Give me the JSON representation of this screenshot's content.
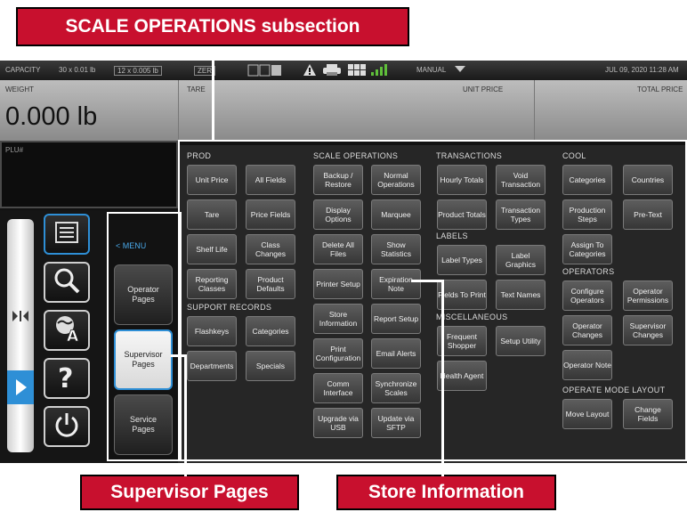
{
  "callouts": {
    "top": "SCALE OPERATIONS subsection",
    "left": "Supervisor Pages",
    "right": "Store Information"
  },
  "status": {
    "capacity": "CAPACITY",
    "cap1": "30 x 0.01 lb",
    "cap2": "12 x 0.005 lb",
    "zero": "ZER",
    "manual": "MANUAL",
    "date": "JUL 09, 2020 11:28 AM"
  },
  "weighbar": {
    "weight_label": "WEIGHT",
    "tare_label": "TARE",
    "unit_price_label": "UNIT PRICE",
    "total_price_label": "TOTAL PRICE",
    "weight_value": "0.000 lb"
  },
  "plu_label": "PLU#",
  "menu_link": "< MENU",
  "pages": {
    "operator": "Operator Pages",
    "supervisor": "Supervisor Pages",
    "service": "Service Pages"
  },
  "sections": {
    "prod": "PROD",
    "support": "SUPPORT RECORDS",
    "scale_ops": "SCALE OPERATIONS",
    "transactions": "TRANSACTIONS",
    "labels": "LABELS",
    "misc": "MISCELLANEOUS",
    "cool": "COOL",
    "operators": "OPERATORS",
    "operate_mode": "OPERATE MODE LAYOUT"
  },
  "buttons": {
    "unit_price": "Unit Price",
    "all_fields": "All Fields",
    "tare": "Tare",
    "price_fields": "Price Fields",
    "shelf_life": "Shelf Life",
    "class_changes": "Class Changes",
    "reporting_classes": "Reporting Classes",
    "product_defaults": "Product Defaults",
    "flashkeys": "Flashkeys",
    "categories": "Categories",
    "departments": "Departments",
    "specials": "Specials",
    "backup_restore": "Backup / Restore",
    "normal_operations": "Normal Operations",
    "display_options": "Display Options",
    "marquee": "Marquee",
    "delete_all_files": "Delete All Files",
    "show_statistics": "Show Statistics",
    "printer_setup": "Printer Setup",
    "expiration_note": "Expiration Note",
    "store_information": "Store Information",
    "report_setup": "Report Setup",
    "print_configuration": "Print Configuration",
    "email_alerts": "Email Alerts",
    "comm_interface": "Comm Interface",
    "synchronize_scales": "Synchronize Scales",
    "upgrade_usb": "Upgrade via USB",
    "update_sftp": "Update via SFTP",
    "hourly_totals": "Hourly Totals",
    "void_transaction": "Void Transaction",
    "product_totals": "Product Totals",
    "transaction_types": "Transaction Types",
    "label_types": "Label Types",
    "label_graphics": "Label Graphics",
    "fields_to_print": "Fields To Print",
    "text_names": "Text Names",
    "frequent_shopper": "Frequent Shopper",
    "setup_utility": "Setup Utility",
    "health_agent": "Health Agent",
    "cool_categories": "Categories",
    "countries": "Countries",
    "production_steps": "Production Steps",
    "pre_text": "Pre-Text",
    "assign_to_categories": "Assign To Categories",
    "configure_operators": "Configure Operators",
    "operator_permissions": "Operator Permissions",
    "operator_changes": "Operator Changes",
    "supervisor_changes": "Supervisor Changes",
    "operator_note": "Operator Note",
    "move_layout": "Move Layout",
    "change_fields": "Change Fields"
  },
  "colors": {
    "callout_red": "#c8102e",
    "active_border": "#2e8fd6",
    "menu_blue": "#4aa8e8"
  }
}
